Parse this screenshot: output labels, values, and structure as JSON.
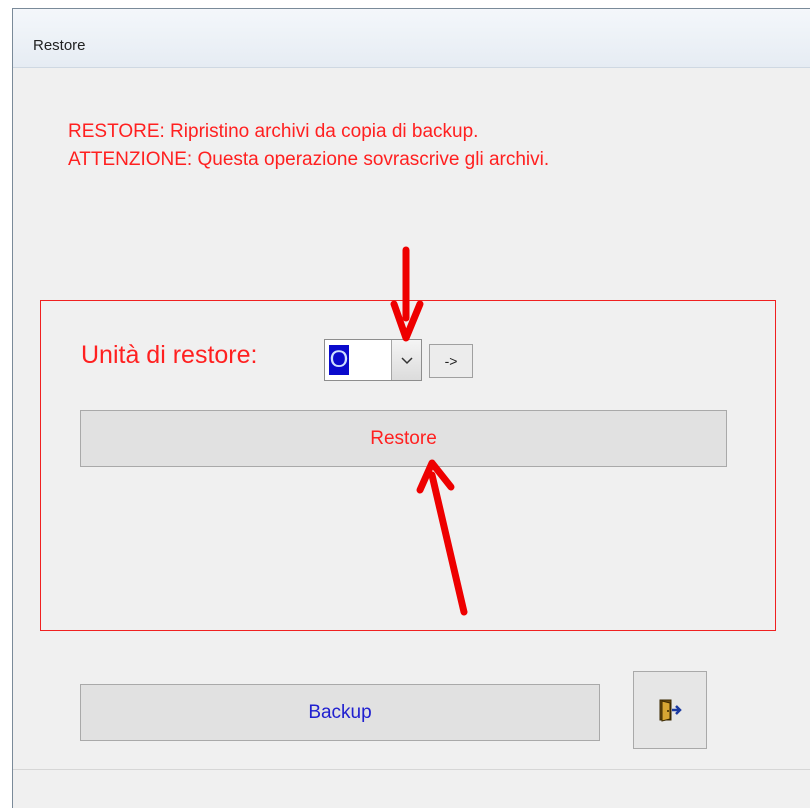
{
  "window": {
    "title": "Restore"
  },
  "messages": {
    "line1": "RESTORE: Ripristino archivi da copia di backup.",
    "line2": "ATTENZIONE: Questa operazione sovrascrive gli archivi."
  },
  "restore_panel": {
    "unit_label": "Unità di restore:",
    "drive_value": "O",
    "go_button": "->",
    "restore_button": "Restore"
  },
  "footer": {
    "backup_button": "Backup",
    "exit_icon": "exit-door-icon"
  },
  "colors": {
    "accent_red": "#ff2020",
    "backup_blue": "#2020d0",
    "annotation_arrow": "#ee0000"
  }
}
